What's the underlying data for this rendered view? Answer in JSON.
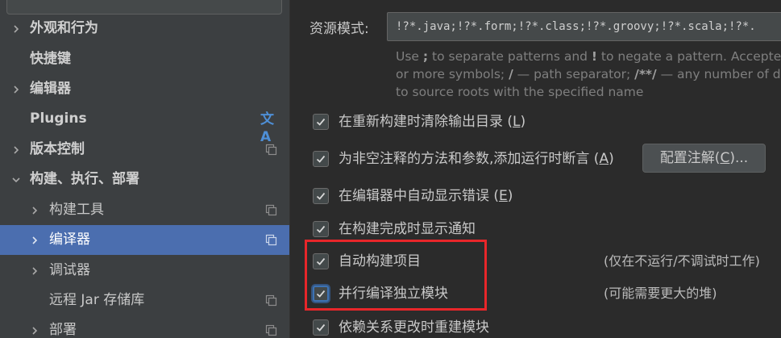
{
  "sidebar": {
    "items": [
      {
        "label": "外观和行为",
        "expandable": true,
        "level": 0,
        "selected": false
      },
      {
        "label": "快捷键",
        "expandable": false,
        "level": 0,
        "selected": false
      },
      {
        "label": "编辑器",
        "expandable": true,
        "level": 0,
        "selected": false
      },
      {
        "label": "Plugins",
        "expandable": false,
        "level": 0,
        "selected": false,
        "icon": "translate-icon"
      },
      {
        "label": "版本控制",
        "expandable": true,
        "level": 0,
        "selected": false,
        "icon": "project-scope-icon"
      },
      {
        "label": "构建、执行、部署",
        "expandable": true,
        "expanded": true,
        "level": 0,
        "selected": false
      },
      {
        "label": "构建工具",
        "expandable": true,
        "level": 1,
        "selected": false,
        "icon": "project-scope-icon"
      },
      {
        "label": "编译器",
        "expandable": true,
        "level": 1,
        "selected": true,
        "icon": "project-scope-icon"
      },
      {
        "label": "调试器",
        "expandable": true,
        "level": 1,
        "selected": false
      },
      {
        "label": "远程 Jar 存储库",
        "expandable": false,
        "level": 1,
        "selected": false,
        "icon": "project-scope-icon"
      },
      {
        "label": "部署",
        "expandable": true,
        "level": 1,
        "selected": false,
        "icon": "project-scope-icon"
      }
    ],
    "translate_glyph": "文A"
  },
  "main": {
    "resource_label": "资源模式:",
    "resource_value": "!?*.java;!?*.form;!?*.class;!?*.groovy;!?*.scala;!?*.",
    "hint": [
      [
        "Use ",
        ";",
        " to separate patterns and ",
        "!",
        " to negate a pattern. Accepted"
      ],
      [
        "or more symbols; ",
        "/",
        " — path separator; ",
        "/**/",
        " — any number of d"
      ],
      [
        "to source roots with the specified name",
        "",
        "",
        "",
        ""
      ]
    ],
    "options": [
      {
        "label": "在重新构建时清除输出目录 (",
        "mnemonic": "L",
        "suffix": ")",
        "checked": true
      },
      {
        "label": "为非空注释的方法和参数,添加运行时断言 (",
        "mnemonic": "A",
        "suffix": ")",
        "checked": true
      },
      {
        "label": "在编辑器中自动显示错误 (",
        "mnemonic": "E",
        "suffix": ")",
        "checked": true
      },
      {
        "label": "在构建完成时显示通知",
        "mnemonic": "",
        "suffix": "",
        "checked": true
      },
      {
        "label": "自动构建项目",
        "mnemonic": "",
        "suffix": "",
        "checked": true
      },
      {
        "label": "并行编译独立模块",
        "mnemonic": "",
        "suffix": "",
        "checked": true,
        "focused": true
      },
      {
        "label": "依赖关系更改时重建模块",
        "mnemonic": "",
        "suffix": "",
        "checked": true
      }
    ],
    "configure_button": {
      "prefix": "配置注解(",
      "mnemonic": "C",
      "suffix": ")..."
    },
    "notes": {
      "auto_build": "(仅在不运行/不调试时工作)",
      "parallel": "(可能需要更大的堆)"
    }
  },
  "colors": {
    "selection": "#4b6eaf",
    "highlight_box": "#e8262a",
    "focus_ring": "#3d72b3"
  }
}
